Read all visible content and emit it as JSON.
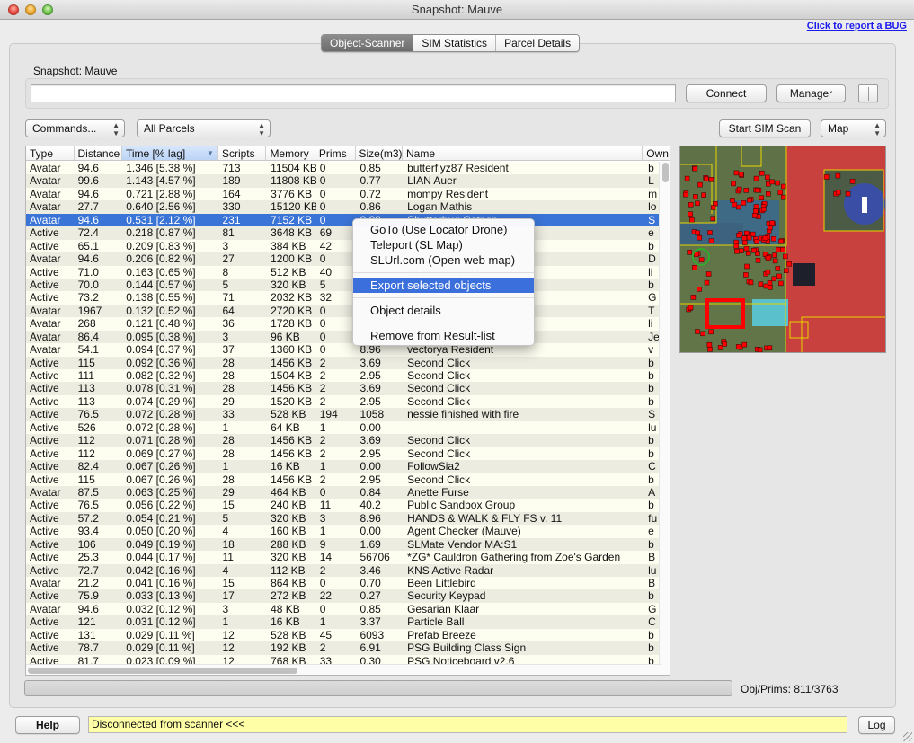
{
  "window": {
    "title": "Snapshot: Mauve"
  },
  "bug_link": "Click to report a BUG",
  "tabs": [
    {
      "label": "Object-Scanner",
      "active": true
    },
    {
      "label": "SIM Statistics",
      "active": false
    },
    {
      "label": "Parcel Details",
      "active": false
    }
  ],
  "snapshot": {
    "label": "Snapshot: Mauve",
    "input_value": "",
    "connect_label": "Connect",
    "manager_label": "Manager"
  },
  "toolbar": {
    "commands_select": "Commands...",
    "parcels_select": "All Parcels",
    "start_scan_label": "Start SIM Scan",
    "view_select": "Map"
  },
  "table": {
    "columns": [
      "Type",
      "Distance",
      "Time [% lag]",
      "Scripts",
      "Memory",
      "Prims",
      "Size(m3)",
      "Name",
      "Own"
    ],
    "sorted_column": "Time [% lag]",
    "selected_row": 4,
    "rows": [
      [
        "Avatar",
        "94.6",
        "1.346 [5.38 %]",
        "713",
        "11504 KB",
        "0",
        "0.85",
        "butterflyz87 Resident",
        "b"
      ],
      [
        "Avatar",
        "99.6",
        "1.143 [4.57 %]",
        "189",
        "11808 KB",
        "0",
        "0.77",
        "LIAN Auer",
        "L"
      ],
      [
        "Avatar",
        "94.6",
        "0.721 [2.88 %]",
        "164",
        "3776 KB",
        "0",
        "0.72",
        "mompy Resident",
        "m"
      ],
      [
        "Avatar",
        "27.7",
        "0.640 [2.56 %]",
        "330",
        "15120 KB",
        "0",
        "0.86",
        "Logan Mathis",
        "lo"
      ],
      [
        "Avatar",
        "94.6",
        "0.531 [2.12 %]",
        "231",
        "7152 KB",
        "0",
        "0.80",
        "Shutterbug Catnap",
        "S"
      ],
      [
        "Active",
        "72.4",
        "0.218 [0.87 %]",
        "81",
        "3648 KB",
        "69",
        "",
        "",
        "e"
      ],
      [
        "Active",
        "65.1",
        "0.209 [0.83 %]",
        "3",
        "384 KB",
        "42",
        "",
        "",
        "b"
      ],
      [
        "Avatar",
        "94.6",
        "0.206 [0.82 %]",
        "27",
        "1200 KB",
        "0",
        "",
        "",
        "D"
      ],
      [
        "Active",
        "71.0",
        "0.163 [0.65 %]",
        "8",
        "512 KB",
        "40",
        "",
        "                              ve Edition 2011",
        "li"
      ],
      [
        "Active",
        "70.0",
        "0.144 [0.57 %]",
        "5",
        "320 KB",
        "5",
        "",
        "",
        "b"
      ],
      [
        "Active",
        "73.2",
        "0.138 [0.55 %]",
        "71",
        "2032 KB",
        "32",
        "",
        "",
        "G"
      ],
      [
        "Avatar",
        "1967",
        "0.132 [0.52 %]",
        "64",
        "2720 KB",
        "0",
        "",
        "",
        "T"
      ],
      [
        "Avatar",
        "268",
        "0.121 [0.48 %]",
        "36",
        "1728 KB",
        "0",
        "",
        "",
        "li"
      ],
      [
        "Avatar",
        "86.4",
        "0.095 [0.38 %]",
        "3",
        "96 KB",
        "0",
        "",
        "",
        "Je"
      ],
      [
        "Avatar",
        "54.1",
        "0.094 [0.37 %]",
        "37",
        "1360 KB",
        "0",
        "8.96",
        "vectorya Resident",
        "v"
      ],
      [
        "Active",
        "115",
        "0.092 [0.36 %]",
        "28",
        "1456 KB",
        "2",
        "3.69",
        "Second Click",
        "b"
      ],
      [
        "Active",
        "111",
        "0.082 [0.32 %]",
        "28",
        "1504 KB",
        "2",
        "2.95",
        "Second Click",
        "b"
      ],
      [
        "Active",
        "113",
        "0.078 [0.31 %]",
        "28",
        "1456 KB",
        "2",
        "3.69",
        "Second Click",
        "b"
      ],
      [
        "Active",
        "113",
        "0.074 [0.29 %]",
        "29",
        "1520 KB",
        "2",
        "2.95",
        "Second Click",
        "b"
      ],
      [
        "Active",
        "76.5",
        "0.072 [0.28 %]",
        "33",
        "528 KB",
        "194",
        "1058",
        "nessie finished with fire",
        "S"
      ],
      [
        "Active",
        "526",
        "0.072 [0.28 %]",
        "1",
        "64 KB",
        "1",
        "0.00",
        "",
        "lu"
      ],
      [
        "Active",
        "112",
        "0.071 [0.28 %]",
        "28",
        "1456 KB",
        "2",
        "3.69",
        "Second Click",
        "b"
      ],
      [
        "Active",
        "112",
        "0.069 [0.27 %]",
        "28",
        "1456 KB",
        "2",
        "2.95",
        "Second Click",
        "b"
      ],
      [
        "Active",
        "82.4",
        "0.067 [0.26 %]",
        "1",
        "16 KB",
        "1",
        "0.00",
        "FollowSia2",
        "C"
      ],
      [
        "Active",
        "115",
        "0.067 [0.26 %]",
        "28",
        "1456 KB",
        "2",
        "2.95",
        "Second Click",
        "b"
      ],
      [
        "Avatar",
        "87.5",
        "0.063 [0.25 %]",
        "29",
        "464 KB",
        "0",
        "0.84",
        "Anette Furse",
        "A"
      ],
      [
        "Active",
        "76.5",
        "0.056 [0.22 %]",
        "15",
        "240 KB",
        "11",
        "40.2",
        "Public Sandbox Group",
        "b"
      ],
      [
        "Active",
        "57.2",
        "0.054 [0.21 %]",
        "5",
        "320 KB",
        "3",
        "8.96",
        "HANDS &  WALK & FLY FS v. 11",
        "fu"
      ],
      [
        "Active",
        "93.4",
        "0.050 [0.20 %]",
        "4",
        "160 KB",
        "1",
        "0.00",
        "Agent Checker (Mauve)",
        "e"
      ],
      [
        "Active",
        "106",
        "0.049 [0.19 %]",
        "18",
        "288 KB",
        "9",
        "1.69",
        "SLMate Vendor MA:S1",
        "b"
      ],
      [
        "Active",
        "25.3",
        "0.044 [0.17 %]",
        "11",
        "320 KB",
        "14",
        "56706",
        "*ZG* Cauldron Gathering from Zoe's Garden",
        "B"
      ],
      [
        "Active",
        "72.7",
        "0.042 [0.16 %]",
        "4",
        "112 KB",
        "2",
        "3.46",
        "KNS Active Radar",
        "lu"
      ],
      [
        "Avatar",
        "21.2",
        "0.041 [0.16 %]",
        "15",
        "864 KB",
        "0",
        "0.70",
        "Been Littlebird",
        "B"
      ],
      [
        "Active",
        "75.9",
        "0.033 [0.13 %]",
        "17",
        "272 KB",
        "22",
        "0.27",
        "Security Keypad",
        "b"
      ],
      [
        "Avatar",
        "94.6",
        "0.032 [0.12 %]",
        "3",
        "48 KB",
        "0",
        "0.85",
        "Gesarian Klaar",
        "G"
      ],
      [
        "Active",
        "121",
        "0.031 [0.12 %]",
        "1",
        "16 KB",
        "1",
        "3.37",
        "Particle Ball",
        "C"
      ],
      [
        "Active",
        "131",
        "0.029 [0.11 %]",
        "12",
        "528 KB",
        "45",
        "6093",
        "Prefab Breeze",
        "b"
      ],
      [
        "Active",
        "78.7",
        "0.029 [0.11 %]",
        "12",
        "192 KB",
        "2",
        "6.91",
        "PSG Building Class Sign",
        "b"
      ],
      [
        "Active",
        "81.7",
        "0.023 [0.09 %]",
        "12",
        "768 KB",
        "33",
        "0.30",
        "PSG Noticeboard v2.6",
        "b"
      ]
    ]
  },
  "context_menu": {
    "groups": [
      [
        "GoTo (Use Locator Drone)",
        "Teleport (SL Map)",
        "SLUrl.com (Open web map)"
      ],
      [
        "Export selected objects"
      ],
      [
        "Object details"
      ],
      [
        "Remove from Result-list"
      ]
    ],
    "highlighted": "Export selected objects"
  },
  "map": {
    "label": "region-map",
    "info_icon": "i"
  },
  "footer": {
    "obj_prims": "Obj/Prims: 811/3763",
    "progress": 0,
    "help_label": "Help",
    "status_text": "Disconnected from scanner <<<",
    "log_label": "Log"
  },
  "colors": {
    "selection": "#3b74d7",
    "menu_highlight": "#3a6fdc",
    "status_bg": "#fefea6",
    "map_object": "#ff0000",
    "parcel_line": "#e8d400"
  }
}
